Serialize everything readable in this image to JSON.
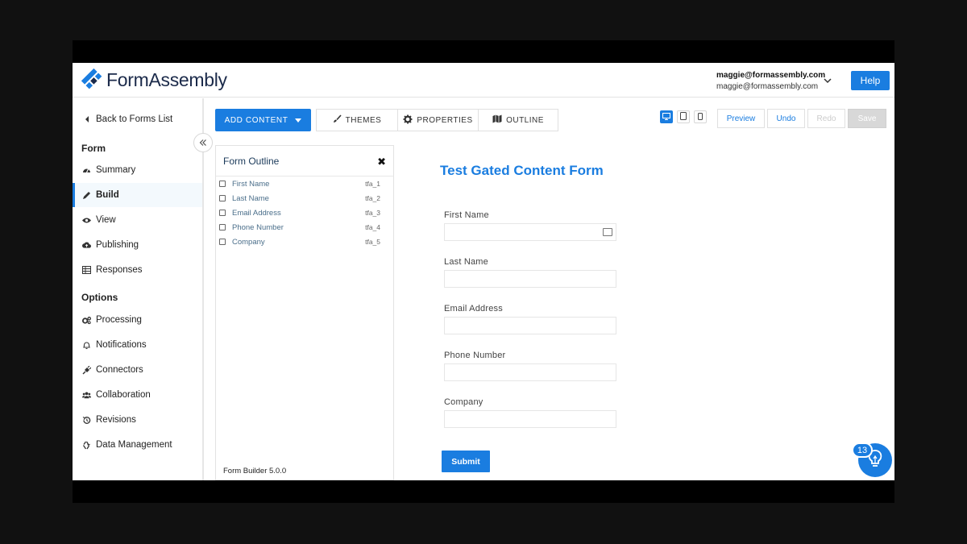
{
  "brand": {
    "name": "FormAssembly",
    "accent": "#1a7de0"
  },
  "header": {
    "user_email_primary": "maggie@formassembly.com",
    "user_email_secondary": "maggie@formassembly.com",
    "help_label": "Help"
  },
  "sidebar": {
    "back_label": "Back to Forms List",
    "form_heading": "Form",
    "form_items": [
      {
        "label": "Summary",
        "icon": "dashboard-icon"
      },
      {
        "label": "Build",
        "icon": "pencil-icon",
        "active": true
      },
      {
        "label": "View",
        "icon": "eye-icon"
      },
      {
        "label": "Publishing",
        "icon": "cloud-upload-icon"
      },
      {
        "label": "Responses",
        "icon": "table-icon"
      }
    ],
    "options_heading": "Options",
    "option_items": [
      {
        "label": "Processing",
        "icon": "gears-icon"
      },
      {
        "label": "Notifications",
        "icon": "bell-icon"
      },
      {
        "label": "Connectors",
        "icon": "plug-icon"
      },
      {
        "label": "Collaboration",
        "icon": "users-icon"
      },
      {
        "label": "Revisions",
        "icon": "history-icon"
      },
      {
        "label": "Data Management",
        "icon": "recycle-icon"
      }
    ]
  },
  "toolbar": {
    "add_content_label": "ADD CONTENT",
    "tabs": [
      {
        "label": "THEMES",
        "icon": "brush-icon"
      },
      {
        "label": "PROPERTIES",
        "icon": "gear-icon"
      },
      {
        "label": "OUTLINE",
        "icon": "map-icon"
      }
    ],
    "preview_label": "Preview",
    "undo_label": "Undo",
    "redo_label": "Redo",
    "save_label": "Save"
  },
  "outline": {
    "title": "Form Outline",
    "rows": [
      {
        "label": "First Name",
        "id": "tfa_1"
      },
      {
        "label": "Last Name",
        "id": "tfa_2"
      },
      {
        "label": "Email Address",
        "id": "tfa_3"
      },
      {
        "label": "Phone Number",
        "id": "tfa_4"
      },
      {
        "label": "Company",
        "id": "tfa_5"
      }
    ],
    "footer": "Form Builder 5.0.0"
  },
  "form": {
    "title": "Test Gated Content Form",
    "fields": [
      {
        "label": "First Name",
        "value": ""
      },
      {
        "label": "Last Name",
        "value": ""
      },
      {
        "label": "Email Address",
        "value": ""
      },
      {
        "label": "Phone Number",
        "value": ""
      },
      {
        "label": "Company",
        "value": ""
      }
    ],
    "submit_label": "Submit"
  },
  "help_widget": {
    "badge_count": "13"
  }
}
